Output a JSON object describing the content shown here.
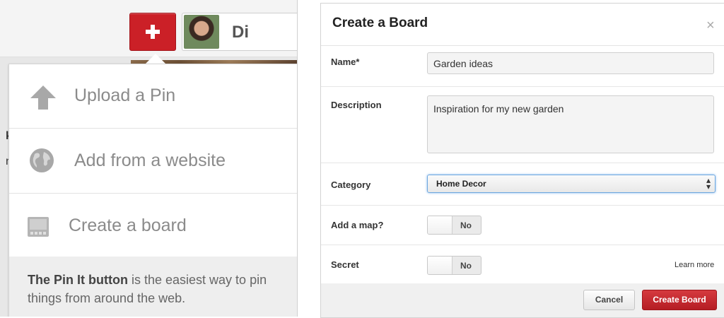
{
  "left_panel": {
    "user": {
      "name": "Di"
    },
    "background_fragments": {
      "a": "",
      "b": "k",
      "c": "n"
    },
    "menu": {
      "items": [
        {
          "label": "Upload a Pin",
          "icon": "upload-arrow-icon"
        },
        {
          "label": "Add from a website",
          "icon": "globe-icon"
        },
        {
          "label": "Create a board",
          "icon": "board-icon"
        }
      ],
      "footer_bold": "The Pin It button",
      "footer_text": " is the easiest way to pin things from around the web."
    }
  },
  "dialog": {
    "title": "Create a Board",
    "close": "×",
    "name_label": "Name*",
    "name_value": "Garden ideas",
    "description_label": "Description",
    "description_value": "Inspiration for my new garden",
    "category_label": "Category",
    "category_value": "Home Decor",
    "map_label": "Add a map?",
    "map_toggle": "No",
    "secret_label": "Secret",
    "secret_toggle": "No",
    "learn_more": "Learn more",
    "cancel_label": "Cancel",
    "create_label": "Create Board"
  },
  "colors": {
    "accent_red": "#cb2027",
    "select_focus_blue": "#6ea7df"
  }
}
